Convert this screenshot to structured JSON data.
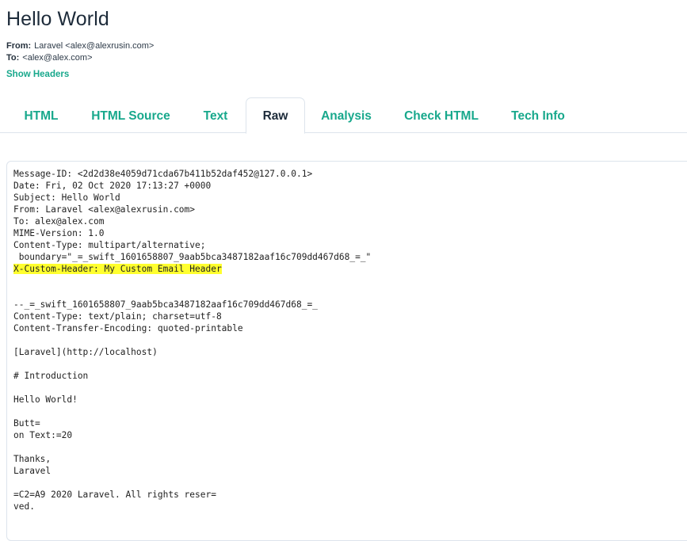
{
  "email": {
    "subject": "Hello World",
    "from_label": "From:",
    "from_value": "Laravel <alex@alexrusin.com>",
    "to_label": "To:",
    "to_value": "<alex@alex.com>",
    "show_headers_link": "Show Headers"
  },
  "tabs": [
    {
      "label": "HTML",
      "active": false
    },
    {
      "label": "HTML Source",
      "active": false
    },
    {
      "label": "Text",
      "active": false
    },
    {
      "label": "Raw",
      "active": true
    },
    {
      "label": "Analysis",
      "active": false
    },
    {
      "label": "Check HTML",
      "active": false
    },
    {
      "label": "Tech Info",
      "active": false
    }
  ],
  "colors": {
    "accent": "#18a88c",
    "title": "#1d2b3a",
    "highlight": "#ffff2e",
    "border": "#dde4ec"
  },
  "raw": {
    "lines": [
      "Message-ID: <2d2d38e4059d71cda67b411b52daf452@127.0.0.1>",
      "Date: Fri, 02 Oct 2020 17:13:27 +0000",
      "Subject: Hello World",
      "From: Laravel <alex@alexrusin.com>",
      "To: alex@alex.com",
      "MIME-Version: 1.0",
      "Content-Type: multipart/alternative;",
      " boundary=\"_=_swift_1601658807_9aab5bca3487182aaf16c709dd467d68_=_\"",
      "X-Custom-Header: My Custom Email Header",
      "",
      "",
      "--_=_swift_1601658807_9aab5bca3487182aaf16c709dd467d68_=_",
      "Content-Type: text/plain; charset=utf-8",
      "Content-Transfer-Encoding: quoted-printable",
      "",
      "[Laravel](http://localhost)",
      "",
      "# Introduction",
      "",
      "Hello World!",
      "",
      "Butt=",
      "on Text:=20",
      "",
      "Thanks,",
      "Laravel",
      "",
      "=C2=A9 2020 Laravel. All rights reser=",
      "ved."
    ],
    "highlighted_line_index": 8
  }
}
